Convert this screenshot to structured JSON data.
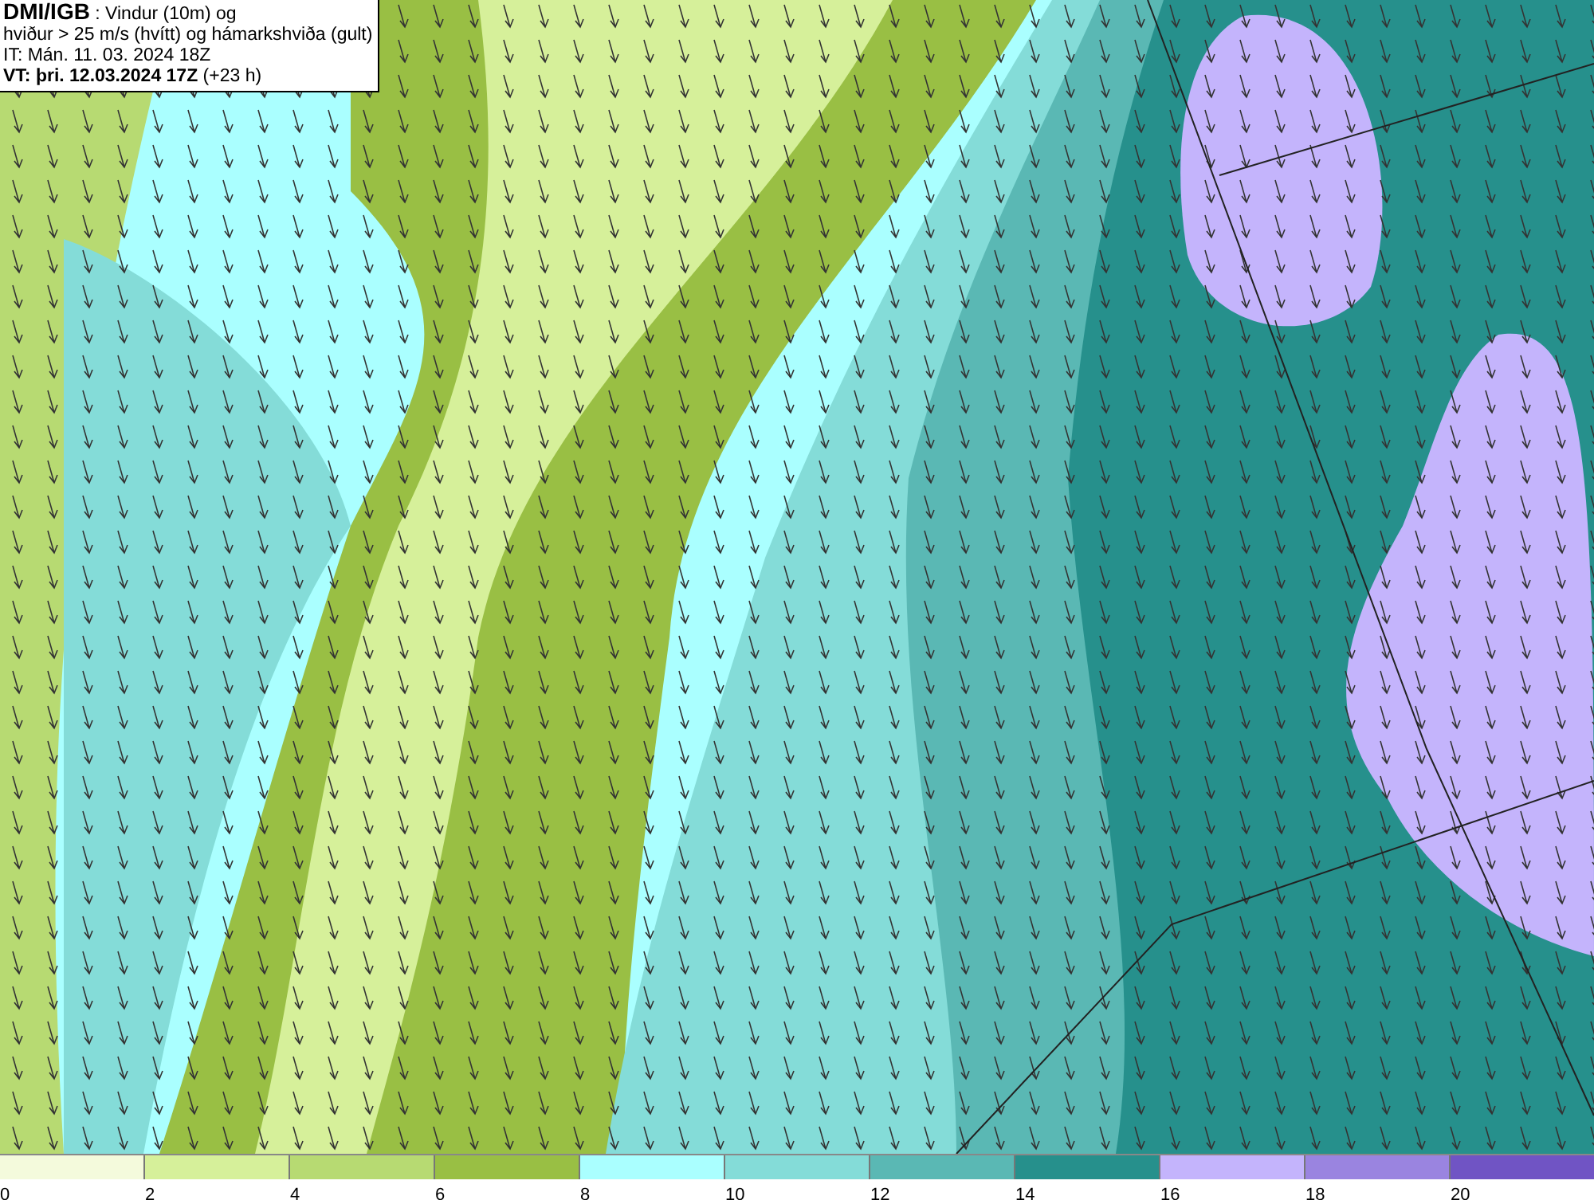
{
  "header": {
    "lines": [
      "**DMI/IGB** : Vindur (10m) og",
      "hviður > 25 m/s (hvítt) og hámarkshviða (gult)",
      "IT: Mán. 11. 03. 2024 18Z",
      "**VT: þri. 12.03.2024 17Z** (+23 h)"
    ]
  },
  "legend": {
    "bins": [
      {
        "color": "#f4fadc"
      },
      {
        "color": "#d6f09a"
      },
      {
        "color": "#b7da72"
      },
      {
        "color": "#99bf44"
      },
      {
        "color": "#aaffff"
      },
      {
        "color": "#84dcd8"
      },
      {
        "color": "#5ab8b4"
      },
      {
        "color": "#26908c"
      },
      {
        "color": "#c4b4fc"
      },
      {
        "color": "#9a84e0"
      },
      {
        "color": "#7054c4"
      }
    ],
    "ticks": [
      "0",
      "2",
      "4",
      "6",
      "8",
      "10",
      "12",
      "14",
      "16",
      "18",
      "20"
    ]
  }
}
